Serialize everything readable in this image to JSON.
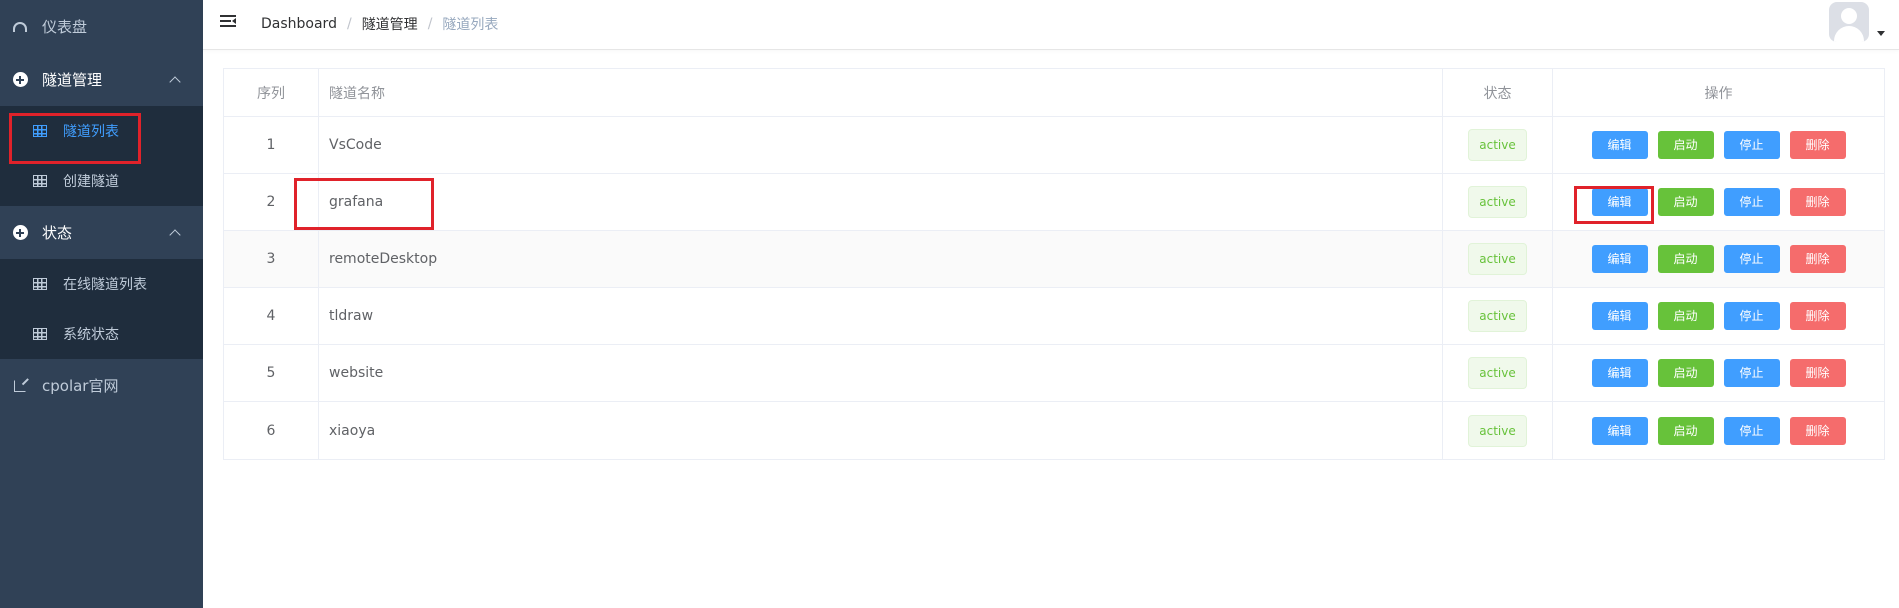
{
  "sidebar": {
    "dashboard_label": "仪表盘",
    "tunnel_group_label": "隧道管理",
    "tunnel_items": [
      "隧道列表",
      "创建隧道"
    ],
    "status_group_label": "状态",
    "status_items": [
      "在线隧道列表",
      "系统状态"
    ],
    "external_link_label": "cpolar官网"
  },
  "header": {
    "breadcrumb": [
      "Dashboard",
      "隧道管理",
      "隧道列表"
    ],
    "separator": "/"
  },
  "table": {
    "columns": [
      "序列",
      "隧道名称",
      "状态",
      "操作"
    ],
    "rows": [
      {
        "index": "1",
        "name": "VsCode",
        "status": "active"
      },
      {
        "index": "2",
        "name": "grafana",
        "status": "active"
      },
      {
        "index": "3",
        "name": "remoteDesktop",
        "status": "active"
      },
      {
        "index": "4",
        "name": "tldraw",
        "status": "active"
      },
      {
        "index": "5",
        "name": "website",
        "status": "active"
      },
      {
        "index": "6",
        "name": "xiaoya",
        "status": "active"
      }
    ],
    "actions": {
      "edit": "编辑",
      "start": "启动",
      "stop": "停止",
      "delete": "删除"
    }
  },
  "colors": {
    "sidebar_bg": "#304156",
    "submenu_bg": "#1f2d3d",
    "active_menu": "#409eff",
    "primary": "#409eff",
    "success": "#67c23a",
    "danger": "#f56c6c",
    "highlight_box": "#e0222a"
  }
}
